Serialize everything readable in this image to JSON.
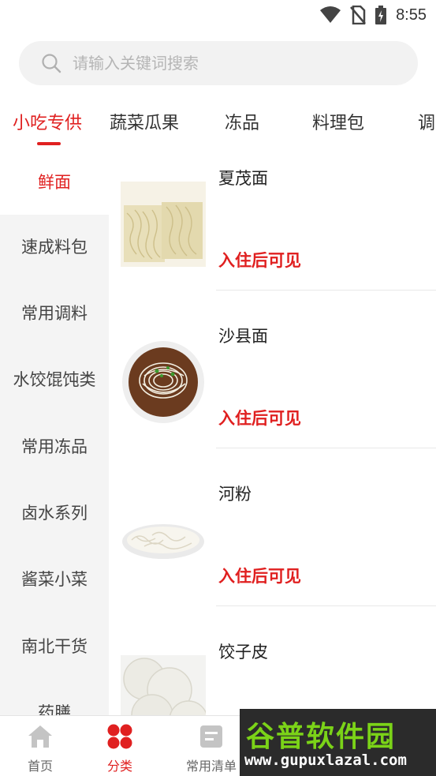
{
  "status_bar": {
    "time": "8:55"
  },
  "search": {
    "placeholder": "请输入关键词搜索"
  },
  "tabs": [
    {
      "label": "小吃专供",
      "active": true
    },
    {
      "label": "蔬菜瓜果"
    },
    {
      "label": "冻品"
    },
    {
      "label": "料理包"
    },
    {
      "label": "调"
    }
  ],
  "categories": [
    {
      "label": "鲜面",
      "active": true
    },
    {
      "label": "速成料包"
    },
    {
      "label": "常用调料"
    },
    {
      "label": "水饺馄饨类"
    },
    {
      "label": "常用冻品"
    },
    {
      "label": "卤水系列"
    },
    {
      "label": "酱菜小菜"
    },
    {
      "label": "南北干货"
    },
    {
      "label": "药膳"
    }
  ],
  "products": [
    {
      "name": "夏茂面",
      "price_note": "入住后可见"
    },
    {
      "name": "沙县面",
      "price_note": "入住后可见"
    },
    {
      "name": "河粉",
      "price_note": "入住后可见"
    },
    {
      "name": "饺子皮"
    }
  ],
  "bottom_nav": [
    {
      "label": "首页",
      "icon": "home-icon"
    },
    {
      "label": "分类",
      "icon": "category-grid-icon",
      "active": true
    },
    {
      "label": "常用清单",
      "icon": "list-icon"
    }
  ],
  "watermark": {
    "title": "谷普软件园",
    "url": "www.gupuxlazal.com"
  },
  "colors": {
    "accent": "#e02020",
    "sidebar_bg": "#f4f4f4",
    "search_bg": "#f2f2f2"
  }
}
